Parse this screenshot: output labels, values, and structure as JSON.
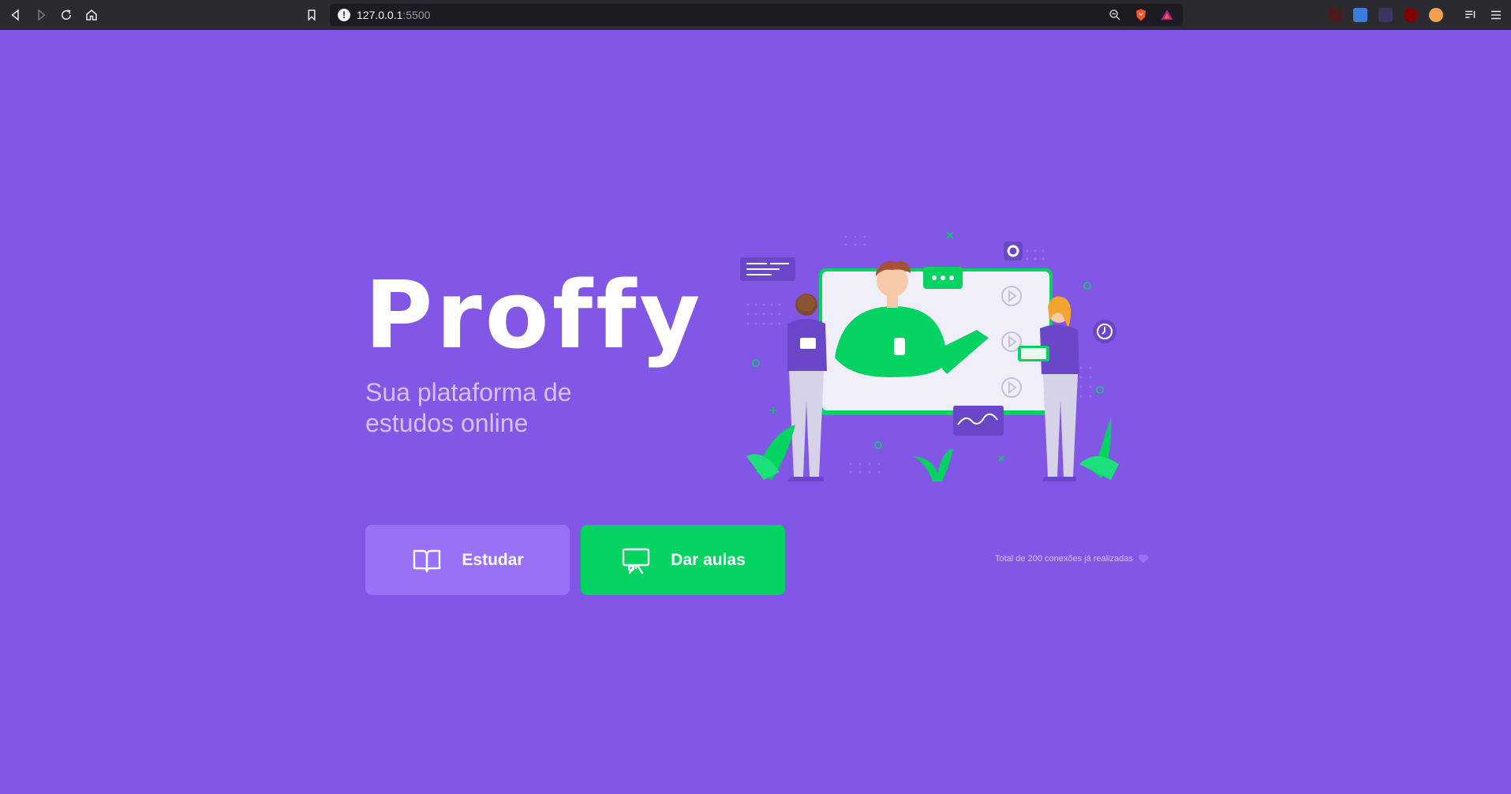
{
  "browser": {
    "url_host": "127.0.0.1",
    "url_port": ":5500"
  },
  "page": {
    "logo": "Proffy",
    "tagline": "Sua plataforma de estudos online",
    "buttons": {
      "study_label": "Estudar",
      "teach_label": "Dar aulas"
    },
    "connections_text": "Total de 200 conexões já realizadas"
  },
  "colors": {
    "background": "#8257E5",
    "study_button": "#9871F5",
    "teach_button": "#04D361",
    "tagline": "#D4C2FF"
  },
  "icons": {
    "study": "open-book-icon",
    "teach": "presentation-board-icon",
    "connections": "purple-heart-icon"
  }
}
